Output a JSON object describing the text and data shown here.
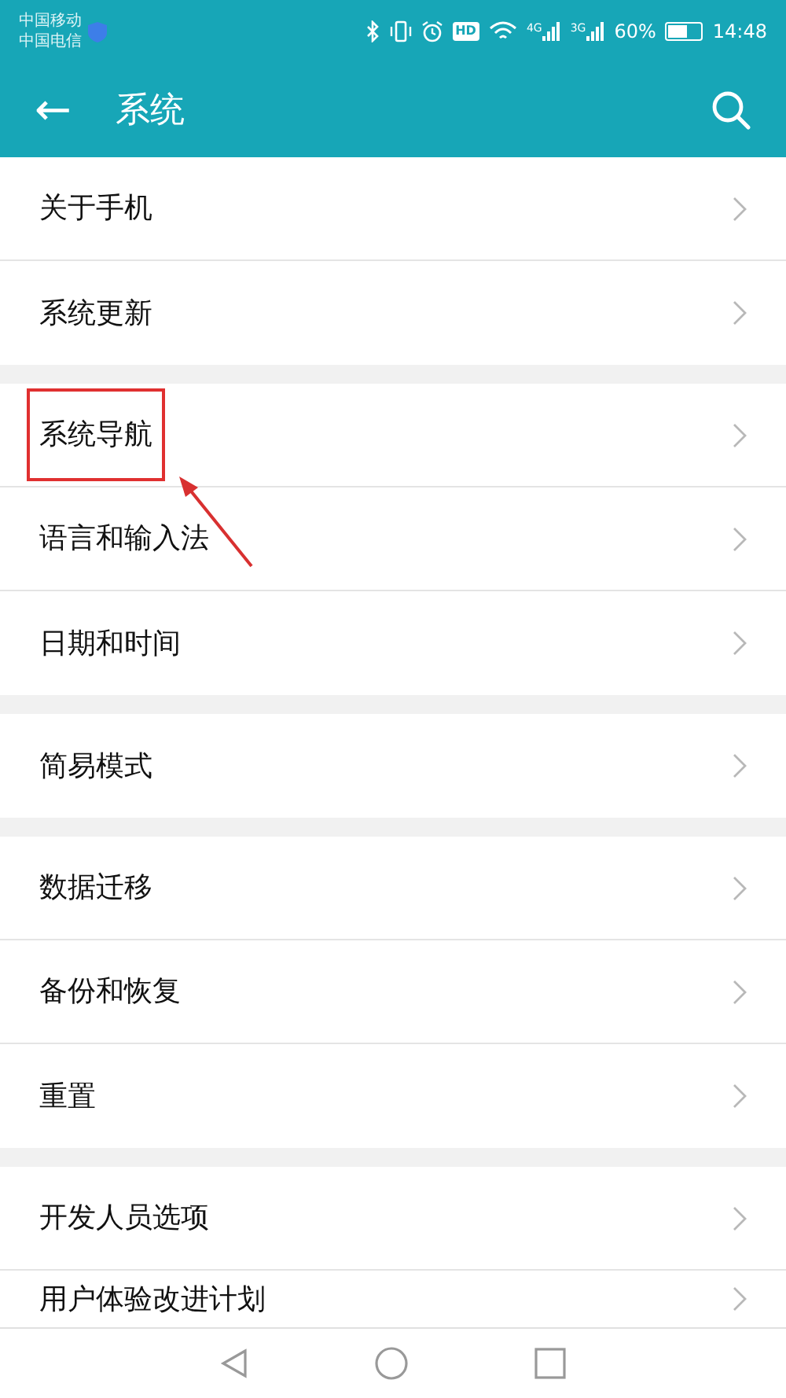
{
  "status_bar": {
    "carriers": [
      "中国移动",
      "中国电信"
    ],
    "network_badges": [
      "4G",
      "3G"
    ],
    "hd": "HD",
    "battery_text": "60%",
    "battery": {
      "level": 0.6
    },
    "time": "14:48"
  },
  "header": {
    "back": "←",
    "title": "系统"
  },
  "groups": [
    {
      "items": [
        {
          "label": "关于手机",
          "highlighted": false
        },
        {
          "label": "系统更新",
          "highlighted": false
        }
      ]
    },
    {
      "items": [
        {
          "label": "系统导航",
          "highlighted": true
        },
        {
          "label": "语言和输入法",
          "highlighted": false
        },
        {
          "label": "日期和时间",
          "highlighted": false
        }
      ]
    },
    {
      "items": [
        {
          "label": "简易模式",
          "highlighted": false
        }
      ]
    },
    {
      "items": [
        {
          "label": "数据迁移",
          "highlighted": false
        },
        {
          "label": "备份和恢复",
          "highlighted": false
        },
        {
          "label": "重置",
          "highlighted": false
        }
      ]
    },
    {
      "items": [
        {
          "label": "开发人员选项",
          "highlighted": false
        },
        {
          "label": "用户体验改进计划",
          "highlighted": false
        }
      ]
    }
  ]
}
